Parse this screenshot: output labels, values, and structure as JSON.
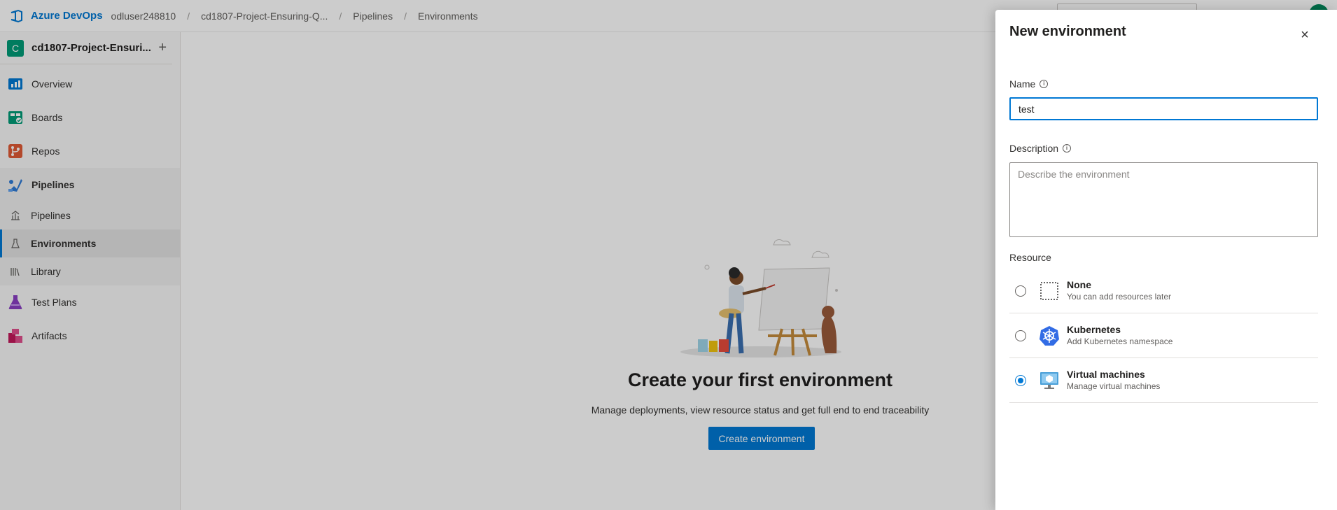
{
  "topbar": {
    "brand": "Azure DevOps",
    "breadcrumb": [
      "odluser248810",
      "cd1807-Project-Ensuring-Q...",
      "Pipelines",
      "Environments"
    ],
    "separator": "/"
  },
  "sidebar": {
    "project_initial": "C",
    "project_name": "cd1807-Project-Ensuri...",
    "add_symbol": "+",
    "items": [
      {
        "label": "Overview",
        "icon": "overview-icon",
        "color": "#0078d4"
      },
      {
        "label": "Boards",
        "icon": "boards-icon",
        "color": "#009b77"
      },
      {
        "label": "Repos",
        "icon": "repos-icon",
        "color": "#e05b36"
      },
      {
        "label": "Pipelines",
        "icon": "pipelines-icon",
        "color": "#2f7bd6"
      },
      {
        "label": "Test Plans",
        "icon": "test-plans-icon",
        "color": "#8a3fc4"
      },
      {
        "label": "Artifacts",
        "icon": "artifacts-icon",
        "color": "#c2185b"
      }
    ],
    "pipeline_sub": [
      {
        "label": "Pipelines",
        "icon": "pipelines-list-icon"
      },
      {
        "label": "Environments",
        "icon": "environments-icon"
      },
      {
        "label": "Library",
        "icon": "library-icon"
      }
    ]
  },
  "main": {
    "title": "Create your first environment",
    "subtitle": "Manage deployments, view resource status and get full end to end traceability",
    "button": "Create environment"
  },
  "panel": {
    "title": "New environment",
    "close_symbol": "×",
    "name_label": "Name",
    "name_value": "test",
    "description_label": "Description",
    "description_placeholder": "Describe the environment",
    "resource_label": "Resource",
    "info_symbol": "i",
    "resources": [
      {
        "name": "None",
        "desc": "You can add resources later",
        "icon": "none-resource-icon",
        "checked": false
      },
      {
        "name": "Kubernetes",
        "desc": "Add Kubernetes namespace",
        "icon": "kubernetes-icon",
        "checked": false
      },
      {
        "name": "Virtual machines",
        "desc": "Manage virtual machines",
        "icon": "virtual-machine-icon",
        "checked": true
      }
    ]
  },
  "colors": {
    "accent": "#0078d4",
    "project_badge": "#009b77"
  }
}
